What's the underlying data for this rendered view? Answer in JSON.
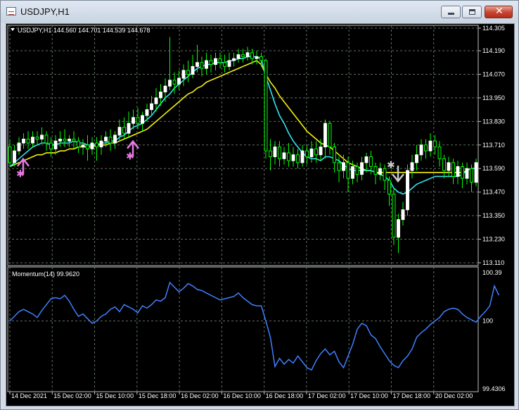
{
  "window": {
    "title": "USDJPY,H1",
    "buttons": {
      "minimize_icon": "minimize-icon",
      "maximize_icon": "maximize-icon",
      "close_icon": "close-icon",
      "close_glyph": "✕"
    }
  },
  "chart_header": "USDJPY,H1  144.560 144.701 144.539 144.678",
  "momentum_label": "Momentum(14) 99.9620",
  "colors": {
    "bg": "#000000",
    "grid": "#5f6f5f",
    "bull": "#ffffff",
    "bear": "#00ff00",
    "fast_ma": "#33e4f0",
    "slow_ma": "#f5f00f",
    "momentum": "#3f7fff",
    "buy_arrow": "#e77ae3",
    "sell_arrow": "#c8c8c8"
  },
  "price_axis_ticks": [
    "114.305",
    "114.190",
    "114.070",
    "113.950",
    "113.830",
    "113.710",
    "113.590",
    "113.470",
    "113.350",
    "113.230",
    "113.110"
  ],
  "momentum_axis_ticks": [
    "100.39",
    "100",
    "99.4306"
  ],
  "time_axis_ticks": [
    "14 Dec 2021",
    "15 Dec 02:00",
    "15 Dec 10:00",
    "15 Dec 18:00",
    "16 Dec 02:00",
    "16 Dec 10:00",
    "16 Dec 18:00",
    "17 Dec 02:00",
    "17 Dec 10:00",
    "17 Dec 18:00",
    "20 Dec 02:00"
  ],
  "chart_data": {
    "type": "candlestick",
    "symbol": "USDJPY",
    "timeframe": "H1",
    "price_range": [
      113.11,
      114.305
    ],
    "candles": [
      [
        113.7,
        113.62,
        113.74,
        113.6
      ],
      [
        113.62,
        113.68,
        113.71,
        113.6
      ],
      [
        113.68,
        113.72,
        113.75,
        113.66
      ],
      [
        113.72,
        113.74,
        113.77,
        113.69
      ],
      [
        113.74,
        113.72,
        113.78,
        113.69
      ],
      [
        113.72,
        113.75,
        113.78,
        113.7
      ],
      [
        113.75,
        113.74,
        113.78,
        113.71
      ],
      [
        113.74,
        113.76,
        113.8,
        113.72
      ],
      [
        113.76,
        113.72,
        113.78,
        113.68
      ],
      [
        113.72,
        113.69,
        113.75,
        113.65
      ],
      [
        113.69,
        113.73,
        113.76,
        113.66
      ],
      [
        113.73,
        113.74,
        113.78,
        113.7
      ],
      [
        113.74,
        113.73,
        113.79,
        113.7
      ],
      [
        113.73,
        113.74,
        113.76,
        113.7
      ],
      [
        113.74,
        113.73,
        113.78,
        113.69
      ],
      [
        113.73,
        113.7,
        113.75,
        113.67
      ],
      [
        113.7,
        113.71,
        113.74,
        113.66
      ],
      [
        113.71,
        113.69,
        113.76,
        113.63
      ],
      [
        113.69,
        113.72,
        113.75,
        113.66
      ],
      [
        113.72,
        113.7,
        113.75,
        113.63
      ],
      [
        113.7,
        113.73,
        113.76,
        113.66
      ],
      [
        113.73,
        113.75,
        113.78,
        113.7
      ],
      [
        113.75,
        113.72,
        113.79,
        113.68
      ],
      [
        113.72,
        113.76,
        113.78,
        113.69
      ],
      [
        113.76,
        113.8,
        113.84,
        113.73
      ],
      [
        113.8,
        113.77,
        113.85,
        113.74
      ],
      [
        113.77,
        113.82,
        113.88,
        113.75
      ],
      [
        113.82,
        113.85,
        113.89,
        113.79
      ],
      [
        113.85,
        113.82,
        113.9,
        113.79
      ],
      [
        113.82,
        113.86,
        113.88,
        113.78
      ],
      [
        113.86,
        113.89,
        113.92,
        113.83
      ],
      [
        113.89,
        113.92,
        113.96,
        113.86
      ],
      [
        113.92,
        113.95,
        114.0,
        113.88
      ],
      [
        113.95,
        113.98,
        114.02,
        113.91
      ],
      [
        113.98,
        114.01,
        114.05,
        113.93
      ],
      [
        114.01,
        114.04,
        114.26,
        113.99
      ],
      [
        114.04,
        114.02,
        114.08,
        113.97
      ],
      [
        114.02,
        114.05,
        114.09,
        113.99
      ],
      [
        114.05,
        114.09,
        114.12,
        114.01
      ],
      [
        114.09,
        114.07,
        114.14,
        114.03
      ],
      [
        114.07,
        114.11,
        114.17,
        114.05
      ],
      [
        114.11,
        114.13,
        114.22,
        114.08
      ],
      [
        114.13,
        114.1,
        114.16,
        114.06
      ],
      [
        114.1,
        114.14,
        114.18,
        114.07
      ],
      [
        114.14,
        114.12,
        114.17,
        114.08
      ],
      [
        114.12,
        114.15,
        114.18,
        114.09
      ],
      [
        114.15,
        114.13,
        114.18,
        114.1
      ],
      [
        114.13,
        114.11,
        114.17,
        114.08
      ],
      [
        114.11,
        114.14,
        114.18,
        114.09
      ],
      [
        114.14,
        114.15,
        114.18,
        114.11
      ],
      [
        114.15,
        114.17,
        114.2,
        114.13
      ],
      [
        114.17,
        114.16,
        114.2,
        114.13
      ],
      [
        114.16,
        114.18,
        114.21,
        114.14
      ],
      [
        114.18,
        114.15,
        114.2,
        114.12
      ],
      [
        114.15,
        114.16,
        114.19,
        114.12
      ],
      [
        114.16,
        114.14,
        114.18,
        114.11
      ],
      [
        114.14,
        113.68,
        114.15,
        113.64
      ],
      [
        113.68,
        113.65,
        113.74,
        113.58
      ],
      [
        113.65,
        113.7,
        113.73,
        113.61
      ],
      [
        113.7,
        113.64,
        113.73,
        113.6
      ],
      [
        113.64,
        113.67,
        113.7,
        113.61
      ],
      [
        113.67,
        113.63,
        113.72,
        113.6
      ],
      [
        113.63,
        113.66,
        113.7,
        113.6
      ],
      [
        113.66,
        113.62,
        113.69,
        113.59
      ],
      [
        113.62,
        113.68,
        113.71,
        113.6
      ],
      [
        113.68,
        113.65,
        113.71,
        113.61
      ],
      [
        113.65,
        113.69,
        113.73,
        113.62
      ],
      [
        113.69,
        113.66,
        113.73,
        113.62
      ],
      [
        113.66,
        113.7,
        113.74,
        113.63
      ],
      [
        113.7,
        113.82,
        113.84,
        113.64
      ],
      [
        113.82,
        113.7,
        113.83,
        113.66
      ],
      [
        113.7,
        113.62,
        113.72,
        113.57
      ],
      [
        113.62,
        113.58,
        113.65,
        113.52
      ],
      [
        113.58,
        113.62,
        113.66,
        113.54
      ],
      [
        113.62,
        113.54,
        113.65,
        113.47
      ],
      [
        113.54,
        113.6,
        113.63,
        113.51
      ],
      [
        113.6,
        113.56,
        113.62,
        113.52
      ],
      [
        113.56,
        113.62,
        113.65,
        113.53
      ],
      [
        113.62,
        113.65,
        113.67,
        113.57
      ],
      [
        113.65,
        113.6,
        113.68,
        113.56
      ],
      [
        113.6,
        113.56,
        113.62,
        113.51
      ],
      [
        113.56,
        113.59,
        113.62,
        113.53
      ],
      [
        113.59,
        113.53,
        113.61,
        113.48
      ],
      [
        113.53,
        113.46,
        113.55,
        113.4
      ],
      [
        113.46,
        113.24,
        113.49,
        113.2
      ],
      [
        113.24,
        113.33,
        113.36,
        113.16
      ],
      [
        113.33,
        113.38,
        113.42,
        113.3
      ],
      [
        113.38,
        113.58,
        113.61,
        113.35
      ],
      [
        113.58,
        113.62,
        113.66,
        113.54
      ],
      [
        113.62,
        113.66,
        113.71,
        113.58
      ],
      [
        113.66,
        113.71,
        113.74,
        113.63
      ],
      [
        113.71,
        113.68,
        113.74,
        113.64
      ],
      [
        113.68,
        113.73,
        113.77,
        113.65
      ],
      [
        113.73,
        113.7,
        113.76,
        113.66
      ],
      [
        113.7,
        113.64,
        113.73,
        113.6
      ],
      [
        113.64,
        113.58,
        113.66,
        113.54
      ],
      [
        113.58,
        113.62,
        113.65,
        113.55
      ],
      [
        113.62,
        113.55,
        113.64,
        113.51
      ],
      [
        113.55,
        113.6,
        113.63,
        113.51
      ],
      [
        113.6,
        113.54,
        113.62,
        113.49
      ],
      [
        113.54,
        113.59,
        113.62,
        113.51
      ],
      [
        113.59,
        113.52,
        113.61,
        113.47
      ],
      [
        113.52,
        113.62,
        113.64,
        113.5
      ]
    ],
    "fast_ma": [
      113.6,
      113.62,
      113.64,
      113.66,
      113.68,
      113.7,
      113.71,
      113.72,
      113.72,
      113.71,
      113.71,
      113.72,
      113.72,
      113.72,
      113.73,
      113.72,
      113.72,
      113.71,
      113.71,
      113.71,
      113.72,
      113.72,
      113.73,
      113.73,
      113.75,
      113.76,
      113.78,
      113.8,
      113.81,
      113.82,
      113.84,
      113.86,
      113.89,
      113.92,
      113.95,
      113.97,
      114.0,
      114.02,
      114.04,
      114.06,
      114.08,
      114.1,
      114.11,
      114.12,
      114.12,
      114.13,
      114.13,
      114.13,
      114.14,
      114.14,
      114.15,
      114.15,
      114.16,
      114.16,
      114.16,
      114.15,
      114.06,
      113.99,
      113.92,
      113.86,
      113.82,
      113.77,
      113.73,
      113.7,
      113.67,
      113.65,
      113.64,
      113.64,
      113.63,
      113.65,
      113.65,
      113.64,
      113.63,
      113.61,
      113.59,
      113.58,
      113.58,
      113.58,
      113.58,
      113.58,
      113.57,
      113.56,
      113.55,
      113.53,
      113.49,
      113.47,
      113.46,
      113.47,
      113.49,
      113.51,
      113.52,
      113.53,
      113.54,
      113.55,
      113.55,
      113.55,
      113.55,
      113.55,
      113.55,
      113.56,
      113.58,
      113.59,
      113.59
    ],
    "slow_ma": [
      113.6,
      113.61,
      113.62,
      113.63,
      113.64,
      113.65,
      113.66,
      113.66,
      113.67,
      113.67,
      113.67,
      113.68,
      113.68,
      113.69,
      113.69,
      113.7,
      113.7,
      113.7,
      113.7,
      113.71,
      113.71,
      113.71,
      113.72,
      113.72,
      113.73,
      113.74,
      113.75,
      113.76,
      113.77,
      113.78,
      113.79,
      113.81,
      113.83,
      113.85,
      113.87,
      113.89,
      113.91,
      113.93,
      113.95,
      113.97,
      113.98,
      114.0,
      114.01,
      114.03,
      114.04,
      114.05,
      114.06,
      114.07,
      114.08,
      114.09,
      114.1,
      114.11,
      114.12,
      114.13,
      114.14,
      114.12,
      114.07,
      114.03,
      114.0,
      113.96,
      113.93,
      113.9,
      113.87,
      113.84,
      113.81,
      113.78,
      113.76,
      113.74,
      113.72,
      113.71,
      113.7,
      113.68,
      113.66,
      113.64,
      113.62,
      113.61,
      113.6,
      113.59,
      113.58,
      113.58,
      113.57,
      113.57,
      113.57,
      113.57,
      113.57,
      113.57,
      113.57,
      113.57,
      113.57,
      113.57,
      113.57,
      113.57,
      113.57,
      113.57,
      113.57,
      113.57,
      113.57,
      113.57,
      113.57,
      113.57,
      113.58,
      113.59,
      113.59
    ],
    "signals": [
      {
        "type": "buy",
        "index": 2
      },
      {
        "type": "buy",
        "index": 26
      },
      {
        "type": "sell",
        "index": 84
      }
    ],
    "momentum": {
      "range": [
        99.4306,
        100.39
      ],
      "values": [
        100.0,
        100.04,
        100.08,
        100.1,
        100.08,
        100.06,
        100.03,
        100.09,
        100.14,
        100.19,
        100.2,
        100.19,
        100.22,
        100.17,
        100.1,
        100.04,
        100.06,
        100.02,
        99.98,
        100.0,
        100.04,
        100.06,
        100.1,
        100.12,
        100.08,
        100.14,
        100.12,
        100.1,
        100.07,
        100.13,
        100.11,
        100.14,
        100.18,
        100.17,
        100.2,
        100.33,
        100.29,
        100.25,
        100.28,
        100.32,
        100.3,
        100.27,
        100.26,
        100.24,
        100.22,
        100.2,
        100.18,
        100.19,
        100.2,
        100.21,
        100.24,
        100.2,
        100.17,
        100.14,
        100.13,
        100.13,
        100.0,
        99.86,
        99.61,
        99.68,
        99.63,
        99.67,
        99.64,
        99.7,
        99.65,
        99.6,
        99.58,
        99.66,
        99.72,
        99.76,
        99.71,
        99.74,
        99.65,
        99.6,
        99.7,
        99.8,
        99.93,
        99.98,
        99.96,
        99.88,
        99.85,
        99.78,
        99.72,
        99.66,
        99.62,
        99.6,
        99.66,
        99.7,
        99.76,
        99.86,
        99.9,
        99.93,
        99.97,
        100.0,
        100.03,
        100.08,
        100.1,
        100.11,
        100.1,
        100.06,
        100.03,
        100.01,
        99.99,
        100.04,
        100.08,
        100.13,
        100.3,
        100.22
      ]
    },
    "price_ticks": [
      114.305,
      114.19,
      114.07,
      113.95,
      113.83,
      113.71,
      113.59,
      113.47,
      113.35,
      113.23,
      113.11
    ],
    "grid": true,
    "sub_window": "Momentum(14)"
  }
}
